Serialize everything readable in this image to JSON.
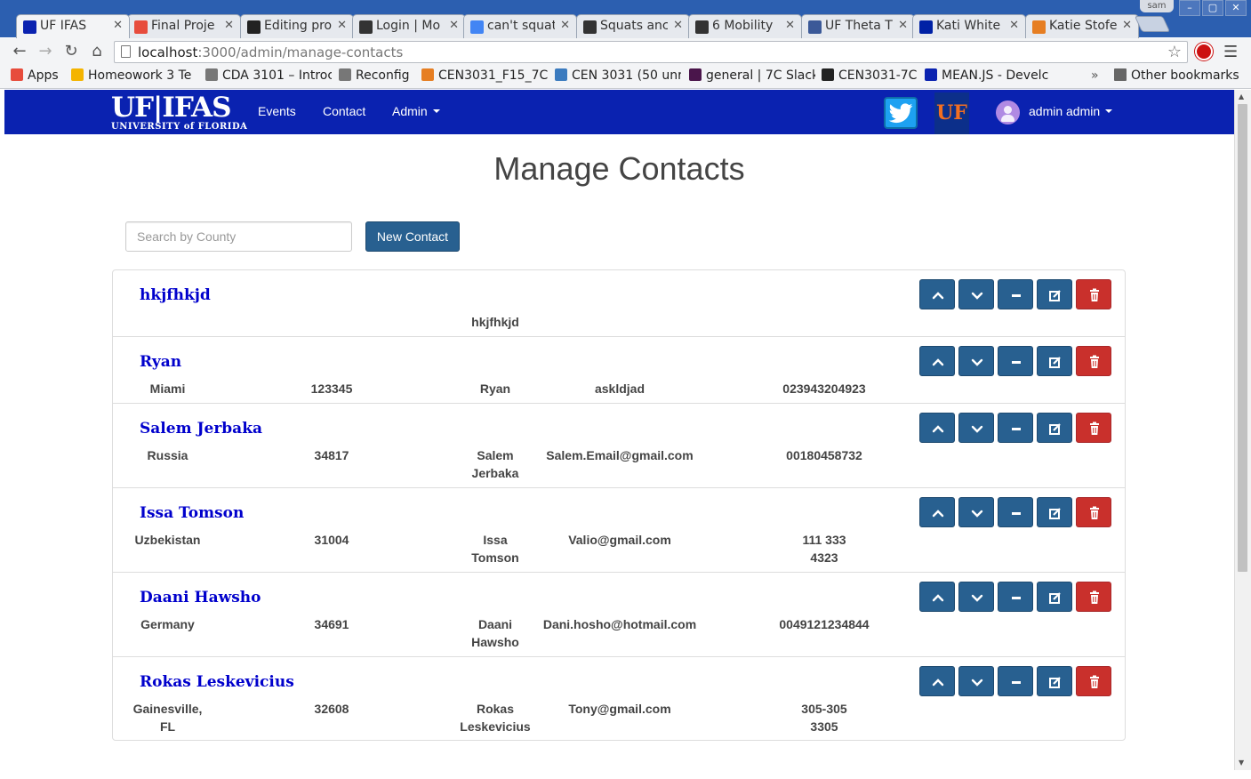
{
  "browser": {
    "tabs": [
      {
        "title": "UF IFAS",
        "icon": "ifas-favicon-icon",
        "color": "#0a22b0"
      },
      {
        "title": "Final Proje",
        "icon": "spinner-favicon-icon",
        "color": "#e74c3c"
      },
      {
        "title": "Editing pro",
        "icon": "github-favicon-icon",
        "color": "#222222"
      },
      {
        "title": "Login | Mo",
        "icon": "key-favicon-icon",
        "color": "#333333"
      },
      {
        "title": "can't squat",
        "icon": "google-favicon-icon",
        "color": "#4285f4"
      },
      {
        "title": "Squats anc",
        "icon": "circle-x-favicon-icon",
        "color": "#333333"
      },
      {
        "title": "6 Mobility",
        "icon": "circle-x-favicon-icon",
        "color": "#333333"
      },
      {
        "title": "UF Theta T",
        "icon": "facebook-favicon-icon",
        "color": "#3b5998"
      },
      {
        "title": "Kati White",
        "icon": "uf-favicon-icon",
        "color": "#0021a5"
      },
      {
        "title": "Katie Stofe",
        "icon": "aec-favicon-icon",
        "color": "#e67e22"
      }
    ],
    "profile_label": "sam",
    "url_host": "localhost",
    "url_path": ":3000/admin/manage-contacts",
    "bookmarks": [
      {
        "label": "Apps",
        "icon": "apps-grid-icon"
      },
      {
        "label": "Homeowork 3 Te",
        "icon": "drive-icon"
      },
      {
        "label": "CDA 3101 – Introc",
        "icon": "page-icon"
      },
      {
        "label": "Reconfig",
        "icon": "page-icon"
      },
      {
        "label": "CEN3031_F15_7C",
        "icon": "circle-icon"
      },
      {
        "label": "CEN 3031 (50 unr",
        "icon": "p-icon"
      },
      {
        "label": "general | 7C Slack",
        "icon": "hash-icon"
      },
      {
        "label": "CEN3031-7C",
        "icon": "github-icon"
      },
      {
        "label": "MEAN.JS - Develc",
        "icon": "ifas-icon"
      }
    ],
    "bookmarks_overflow": "»",
    "other_bookmarks": "Other bookmarks"
  },
  "navbar": {
    "logo_main": "UF|IFAS",
    "logo_sub": "UNIVERSITY of FLORIDA",
    "links": {
      "events": "Events",
      "contact": "Contact",
      "admin": "Admin"
    },
    "uf_badge": "UF",
    "user": "admin admin"
  },
  "page": {
    "title": "Manage Contacts",
    "search_placeholder": "Search by County",
    "new_contact_label": "New Contact"
  },
  "contacts": [
    {
      "name": "hkjfhkjd",
      "county": "",
      "zip": "",
      "person": "hkjfhkjd",
      "email": "",
      "phone": ""
    },
    {
      "name": "Ryan",
      "county": "Miami",
      "zip": "123345",
      "person": "Ryan",
      "email": "askldjad",
      "phone": "023943204923"
    },
    {
      "name": "Salem Jerbaka",
      "county": "Russia",
      "zip": "34817",
      "person": "Salem\nJerbaka",
      "email": "Salem.Email@gmail.com",
      "phone": "00180458732"
    },
    {
      "name": "Issa Tomson",
      "county": "Uzbekistan",
      "zip": "31004",
      "person": "Issa\nTomson",
      "email": "Valio@gmail.com",
      "phone": "111 333\n4323"
    },
    {
      "name": "Daani Hawsho",
      "county": "Germany",
      "zip": "34691",
      "person": "Daani\nHawsho",
      "email": "Dani.hosho@hotmail.com",
      "phone": "0049121234844"
    },
    {
      "name": "Rokas Leskevicius",
      "county": "Gainesville,\nFL",
      "zip": "32608",
      "person": "Rokas\nLeskevicius",
      "email": "Tony@gmail.com",
      "phone": "305-305\n3305"
    }
  ],
  "colors": {
    "navbar": "#0a22b0",
    "primary_button": "#286090",
    "danger_button": "#c9302c",
    "contact_name": "#0000cc"
  }
}
